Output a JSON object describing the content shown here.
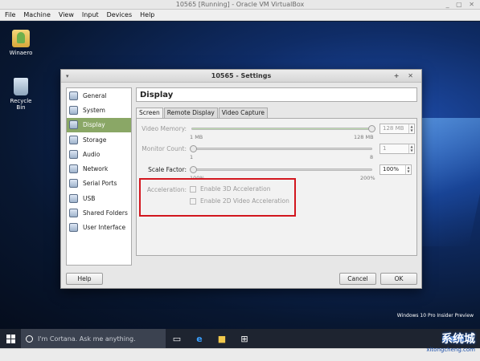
{
  "host": {
    "title": "10565 [Running] - Oracle VM VirtualBox",
    "menu": [
      "File",
      "Machine",
      "View",
      "Input",
      "Devices",
      "Help"
    ]
  },
  "desktop": {
    "icons": [
      {
        "label": "Winaero",
        "icon": "user-folder-icon"
      },
      {
        "label": "Recycle Bin",
        "icon": "recycle-bin-icon"
      }
    ],
    "preview_text": "Windows 10 Pro Insider Preview"
  },
  "taskbar": {
    "cortana_placeholder": "I'm Cortana. Ask me anything."
  },
  "watermark": {
    "text": "系统城",
    "url": "xitongcheng.com"
  },
  "dialog": {
    "title": "10565 - Settings",
    "sidebar": [
      {
        "label": "General",
        "icon": "general-icon"
      },
      {
        "label": "System",
        "icon": "system-icon"
      },
      {
        "label": "Display",
        "icon": "display-icon",
        "selected": true
      },
      {
        "label": "Storage",
        "icon": "storage-icon"
      },
      {
        "label": "Audio",
        "icon": "audio-icon"
      },
      {
        "label": "Network",
        "icon": "network-icon"
      },
      {
        "label": "Serial Ports",
        "icon": "serial-ports-icon"
      },
      {
        "label": "USB",
        "icon": "usb-icon"
      },
      {
        "label": "Shared Folders",
        "icon": "shared-folders-icon"
      },
      {
        "label": "User Interface",
        "icon": "user-interface-icon"
      }
    ],
    "section_title": "Display",
    "tabs": [
      "Screen",
      "Remote Display",
      "Video Capture"
    ],
    "video_memory": {
      "label": "Video Memory:",
      "value": "128 MB",
      "min": "1 MB",
      "max": "128 MB",
      "level": 1.0
    },
    "monitor_count": {
      "label": "Monitor Count:",
      "value": "1",
      "min": "1",
      "max": "8",
      "level": 0.0
    },
    "scale_factor": {
      "label": "Scale Factor:",
      "value": "100%",
      "min": "100%",
      "max": "200%",
      "level": 0.0
    },
    "acceleration": {
      "label": "Acceleration:",
      "options": [
        "Enable 3D Acceleration",
        "Enable 2D Video Acceleration"
      ]
    },
    "buttons": {
      "help": "Help",
      "cancel": "Cancel",
      "ok": "OK"
    }
  },
  "colors": {
    "sidebar_selected": "#8aa766",
    "highlight_box": "#d2161e"
  }
}
